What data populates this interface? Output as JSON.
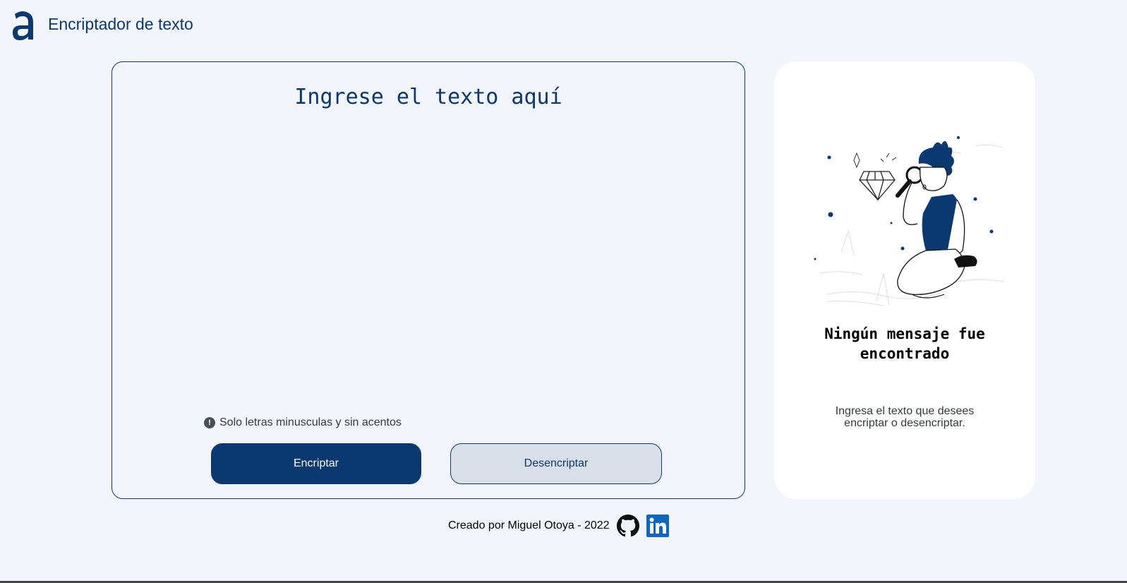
{
  "header": {
    "logo_icon": "alura-a-logo",
    "title": "Encriptador de texto"
  },
  "input": {
    "placeholder": "Ingrese el texto aquí",
    "value": ""
  },
  "hint": {
    "icon": "exclamation-circle-icon",
    "text": "Solo letras minusculas y sin acentos"
  },
  "actions": {
    "encrypt_label": "Encriptar",
    "decrypt_label": "Desencriptar"
  },
  "output": {
    "illustration": "person-with-magnifying-glass-and-diamond",
    "title": "Ningún mensaje fue encontrado",
    "message": "Ingresa el texto que desees encriptar o desencriptar."
  },
  "footer": {
    "credit": "Creado por Miguel Otoya - 2022",
    "github_icon": "github-icon",
    "linkedin_icon": "linkedin-icon"
  },
  "colors": {
    "primary": "#0a3871",
    "background": "#f2f5fc",
    "panel": "#ffffff",
    "secondary_button": "#d8dfe8",
    "linkedin": "#0a66c2"
  }
}
